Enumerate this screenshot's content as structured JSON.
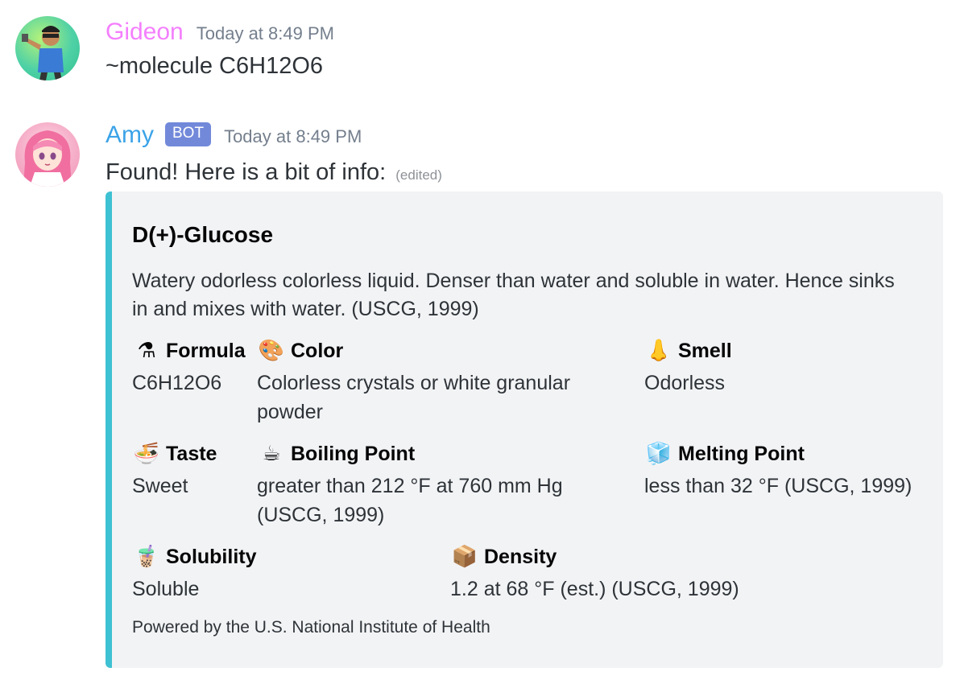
{
  "messages": [
    {
      "username": "Gideon",
      "timestamp": "Today at 8:49 PM",
      "text": "~molecule C6H12O6",
      "avatar_icon": "gideon-avatar"
    },
    {
      "username": "Amy",
      "bot_tag": "BOT",
      "timestamp": "Today at 8:49 PM",
      "text": "Found! Here is a bit of info:",
      "edited": "(edited)",
      "avatar_icon": "amy-avatar"
    }
  ],
  "embed": {
    "accent_color": "#3ec1d3",
    "title": "D(+)-Glucose",
    "description": "Watery odorless colorless liquid. Denser than water and soluble in water. Hence sinks in and mixes with water. (USCG, 1999)",
    "fields": {
      "formula": {
        "icon": "scientist-icon",
        "glyph": "⚗",
        "name": "Formula",
        "value": "C6H12O6"
      },
      "color": {
        "icon": "palette-icon",
        "glyph": "🎨",
        "name": "Color",
        "value": "Colorless crystals or white granular powder"
      },
      "smell": {
        "icon": "nose-icon",
        "glyph": "👃",
        "name": "Smell",
        "value": "Odorless"
      },
      "taste": {
        "icon": "noodle-bowl-icon",
        "glyph": "🍜",
        "name": "Taste",
        "value": "Sweet"
      },
      "boiling": {
        "icon": "hot-beverage-icon",
        "glyph": "☕",
        "name": "Boiling Point",
        "value": "greater than 212 °F at 760 mm Hg (USCG, 1999)"
      },
      "melting": {
        "icon": "ice-cube-icon",
        "glyph": "🧊",
        "name": "Melting Point",
        "value": "less than 32 °F (USCG, 1999)"
      },
      "solubility": {
        "icon": "bubble-tea-icon",
        "glyph": "🧋",
        "name": "Solubility",
        "value": "Soluble"
      },
      "density": {
        "icon": "package-icon",
        "glyph": "📦",
        "name": "Density",
        "value": "1.2 at 68 °F (est.) (USCG, 1999)"
      }
    },
    "footer": "Powered by the U.S. National Institute of Health"
  }
}
